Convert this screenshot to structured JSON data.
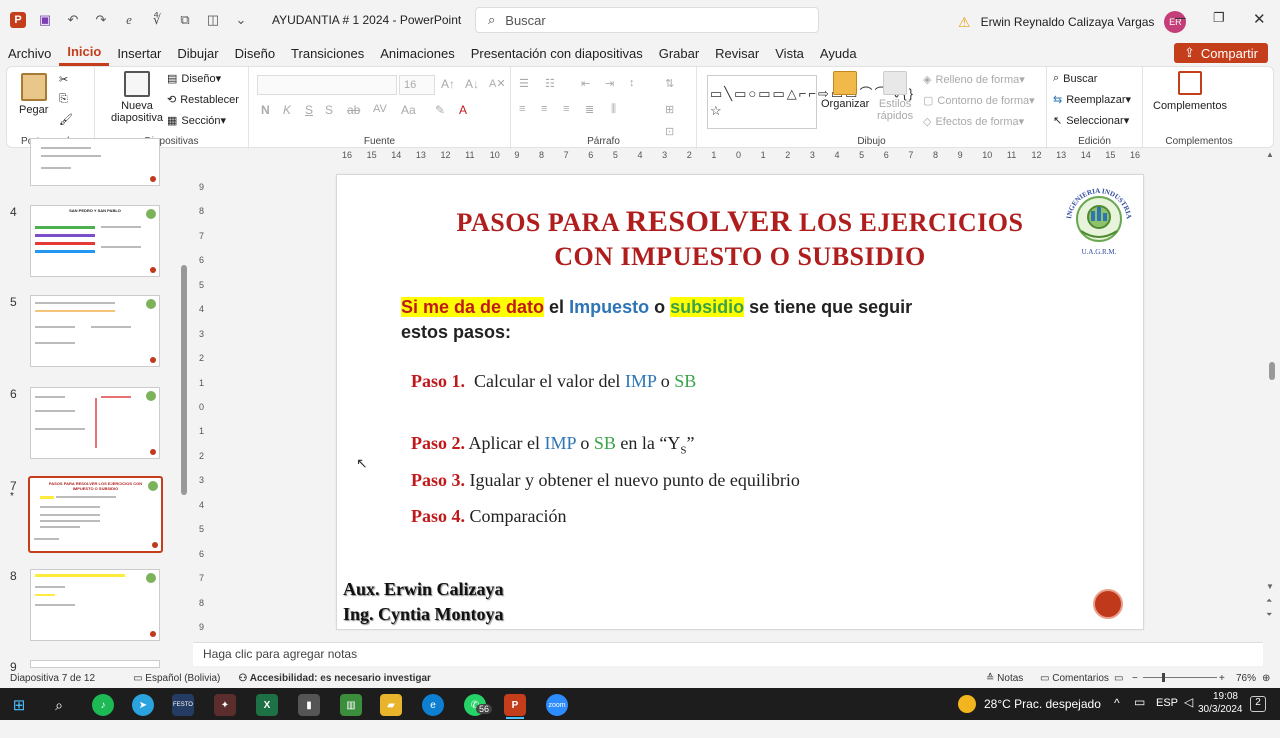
{
  "window": {
    "app_badge": "P",
    "title": "AYUDANTIA # 1 2024  -  PowerPoint",
    "search_placeholder": "Buscar",
    "user_name": "Erwin Reynaldo Calizaya Vargas",
    "user_initials": "ER"
  },
  "menu": {
    "tabs": [
      "Archivo",
      "Inicio",
      "Insertar",
      "Dibujar",
      "Diseño",
      "Transiciones",
      "Animaciones",
      "Presentación con diapositivas",
      "Grabar",
      "Revisar",
      "Vista",
      "Ayuda"
    ],
    "active": "Inicio",
    "share_label": "Compartir"
  },
  "ribbon": {
    "portapapeles": {
      "label": "Portapapeles",
      "pegar": "Pegar"
    },
    "diapositivas": {
      "label": "Diapositivas",
      "nueva": "Nueva",
      "nueva2": "diapositiva",
      "diseno": "Diseño",
      "restablecer": "Restablecer",
      "seccion": "Sección"
    },
    "fuente": {
      "label": "Fuente",
      "size": "16"
    },
    "parrafo": {
      "label": "Párrafo"
    },
    "dibujo": {
      "label": "Dibujo",
      "organizar": "Organizar",
      "estilos": "Estilos",
      "estilos2": "rápidos",
      "relleno": "Relleno de forma",
      "contorno": "Contorno de forma",
      "efectos": "Efectos de forma"
    },
    "edicion": {
      "label": "Edición",
      "buscar": "Buscar",
      "reemplazar": "Reemplazar",
      "seleccionar": "Seleccionar"
    },
    "complementos": {
      "label": "Complementos",
      "btn": "Complementos"
    }
  },
  "thumbnails": [
    {
      "num": "4",
      "title": "SAN PEDRO Y SAN PABLO"
    },
    {
      "num": "5",
      "title": ""
    },
    {
      "num": "6",
      "title": ""
    },
    {
      "num": "7",
      "title": "PASOS PARA RESOLVER LOS EJERCICIOS CON IMPUESTO O SUBSIDIO"
    },
    {
      "num": "8",
      "title": ""
    },
    {
      "num": "9",
      "title": ""
    }
  ],
  "ruler": {
    "h_ticks": [
      "16",
      "15",
      "14",
      "13",
      "12",
      "11",
      "10",
      "9",
      "8",
      "7",
      "6",
      "5",
      "4",
      "3",
      "2",
      "1",
      "0",
      "1",
      "2",
      "3",
      "4",
      "5",
      "6",
      "7",
      "8",
      "9",
      "10",
      "11",
      "12",
      "13",
      "14",
      "15",
      "16"
    ],
    "v_ticks": [
      "9",
      "8",
      "7",
      "6",
      "5",
      "4",
      "3",
      "2",
      "1",
      "0",
      "1",
      "2",
      "3",
      "4",
      "5",
      "6",
      "7",
      "8",
      "9"
    ]
  },
  "slide": {
    "title_line1a": "PASOS PARA ",
    "title_line1b": "RESOLVER",
    "title_line1c": " LOS EJERCICIOS",
    "title_line2": "CON IMPUESTO O SUBSIDIO",
    "intro": {
      "p1": "Si me da de dato",
      "p2": " el ",
      "p3": "Impuesto",
      "p4": " o ",
      "p5": "subsidio",
      "p6": " se tiene que seguir",
      "p7": "estos pasos:"
    },
    "steps": [
      {
        "label": "Paso 1.",
        "a": "  Calcular el valor del ",
        "b": "IMP",
        "c": " o ",
        "d": "SB",
        "e": ""
      },
      {
        "label": "Paso 2.",
        "a": " Aplicar el ",
        "b": "IMP",
        "c": " o ",
        "d": "SB",
        "e": " en la “Y",
        "sub": "S",
        "f": "”"
      },
      {
        "label": "Paso 3.",
        "a": " Igualar y obtener el nuevo punto de equilibrio"
      },
      {
        "label": "Paso 4.",
        "a": " Comparación"
      }
    ],
    "author1": "Aux. Erwin Calizaya",
    "author2": "Ing. Cyntia Montoya",
    "logo_text_top": "INGENIERIA INDUSTRIAL",
    "logo_text_bottom": "U.A.G.R.M."
  },
  "notes_placeholder": "Haga clic para agregar notas",
  "status": {
    "slide_count": "Diapositiva 7 de 12",
    "language": "Español (Bolivia)",
    "accessibility": "Accesibilidad: es necesario investigar",
    "notes": "Notas",
    "comments": "Comentarios",
    "zoom": "76%"
  },
  "taskbar": {
    "weather": "28°C  Prac. despejado",
    "lang": "ESP",
    "time": "19:08",
    "date": "30/3/2024",
    "whatsapp_badge": "56",
    "notif_badge": "2"
  },
  "colors": {
    "accent": "#c43e1c",
    "title_red": "#b01d1d",
    "blue": "#2e75b6",
    "green": "#3aa34a",
    "highlight": "#ffff00"
  }
}
